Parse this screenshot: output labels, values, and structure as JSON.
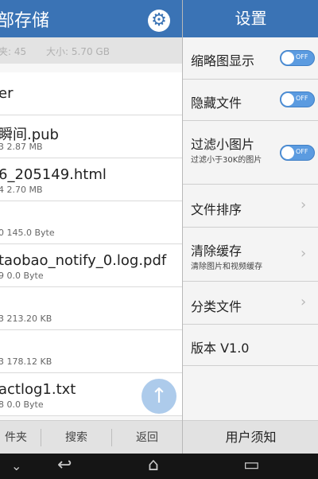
{
  "left": {
    "title": "部存储",
    "stat_folders": "夹: 45",
    "stat_size": "大小: 5.70 GB",
    "files": [
      {
        "name": "er",
        "meta": ""
      },
      {
        "name": "瞬间.pub",
        "meta": "3   2.87 MB"
      },
      {
        "name": "6_205149.html",
        "meta": "4   2.70 MB"
      },
      {
        "name": "",
        "meta": "0   145.0 Byte"
      },
      {
        "name": "taobao_notify_0.log.pdf",
        "meta": "9   0.0 Byte"
      },
      {
        "name": "",
        "meta": "3   213.20 KB"
      },
      {
        "name": "",
        "meta": "3   178.12 KB"
      },
      {
        "name": "actlog1.txt",
        "meta": "8   0.0 Byte"
      }
    ],
    "bottom": {
      "folder": "件夹",
      "search": "搜索",
      "back": "返回"
    },
    "fab_icon": "up-arrow-icon",
    "gear_icon": "gear-icon"
  },
  "settings": {
    "title": "设置",
    "items": [
      {
        "label": "缩略图显示",
        "toggle": "OFF"
      },
      {
        "label": "隐藏文件",
        "toggle": "OFF"
      },
      {
        "label": "过滤小图片",
        "sub": "过滤小于30K的图片",
        "toggle": "OFF"
      },
      {
        "label": "文件排序"
      },
      {
        "label": "清除缓存",
        "sub": "清除图片和视频缓存"
      },
      {
        "label": "分类文件"
      },
      {
        "label": "版本   V1.0"
      }
    ],
    "bottom": "用户须知"
  },
  "colors": {
    "header": "#3a73b5",
    "toggle": "#5b9be0",
    "fab": "#9fc2e8"
  }
}
